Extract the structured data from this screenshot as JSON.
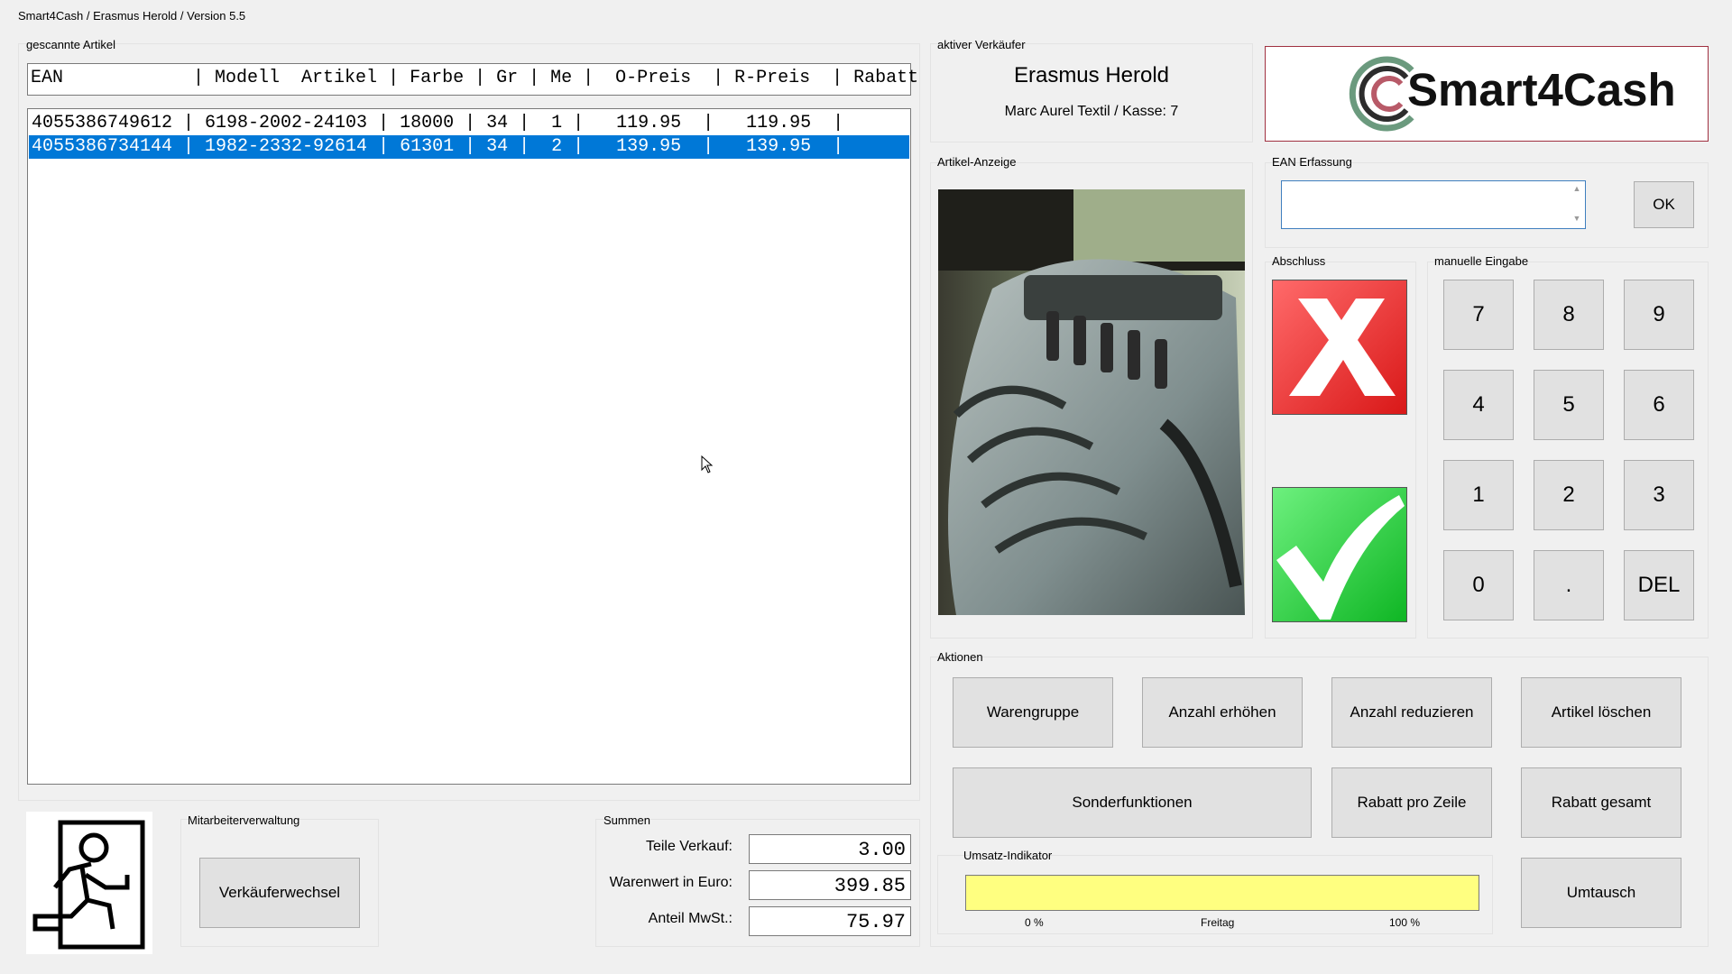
{
  "window": {
    "title": "Smart4Cash / Erasmus Herold / Version 5.5"
  },
  "scanned": {
    "label": "gescannte Artikel",
    "header": "EAN            | Modell  Artikel | Farbe | Gr | Me |  O-Preis  | R-Preis  | Rabatt",
    "rows": [
      {
        "text": "4055386749612 | 6198-2002-24103 | 18000 | 34 |  1 |   119.95  |   119.95  |",
        "selected": false
      },
      {
        "text": "4055386734144 | 1982-2332-92614 | 61301 | 34 |  2 |   139.95  |   139.95  |",
        "selected": true
      }
    ]
  },
  "seller": {
    "label": "aktiver Verkäufer",
    "name": "Erasmus Herold",
    "store": "Marc Aurel Textil / Kasse: 7"
  },
  "logo": {
    "text": "Smart4Cash"
  },
  "article_display": {
    "label": "Artikel-Anzeige"
  },
  "ean": {
    "label": "EAN Erfassung",
    "value": "",
    "ok": "OK"
  },
  "abschluss": {
    "label": "Abschluss"
  },
  "keypad": {
    "label": "manuelle Eingabe",
    "keys": [
      "7",
      "8",
      "9",
      "4",
      "5",
      "6",
      "1",
      "2",
      "3",
      "0",
      ".",
      "DEL"
    ]
  },
  "actions": {
    "label": "Aktionen",
    "warengruppe": "Warengruppe",
    "anzahl_erhoehen": "Anzahl erhöhen",
    "anzahl_reduzieren": "Anzahl reduzieren",
    "artikel_loeschen": "Artikel löschen",
    "sonderfunktionen": "Sonderfunktionen",
    "rabatt_zeile": "Rabatt pro Zeile",
    "rabatt_gesamt": "Rabatt gesamt",
    "umtausch": "Umtausch"
  },
  "umsatz": {
    "label": "Umsatz-Indikator",
    "fill_fraction": 1.0,
    "fill_color": "#ffff80",
    "scale_min": "0 %",
    "scale_mid": "Freitag",
    "scale_max": "100 %"
  },
  "staff": {
    "label": "Mitarbeiterverwaltung",
    "button": "Verkäuferwechsel"
  },
  "summen": {
    "label": "Summen",
    "teile_label": "Teile Verkauf:",
    "teile_value": "3.00",
    "warenwert_label": "Warenwert in Euro:",
    "warenwert_value": "399.85",
    "mwst_label": "Anteil MwSt.:",
    "mwst_value": "75.97"
  },
  "colors": {
    "selection": "#0078d7",
    "cancel": "#e32a2a",
    "confirm": "#1fcf3a"
  }
}
